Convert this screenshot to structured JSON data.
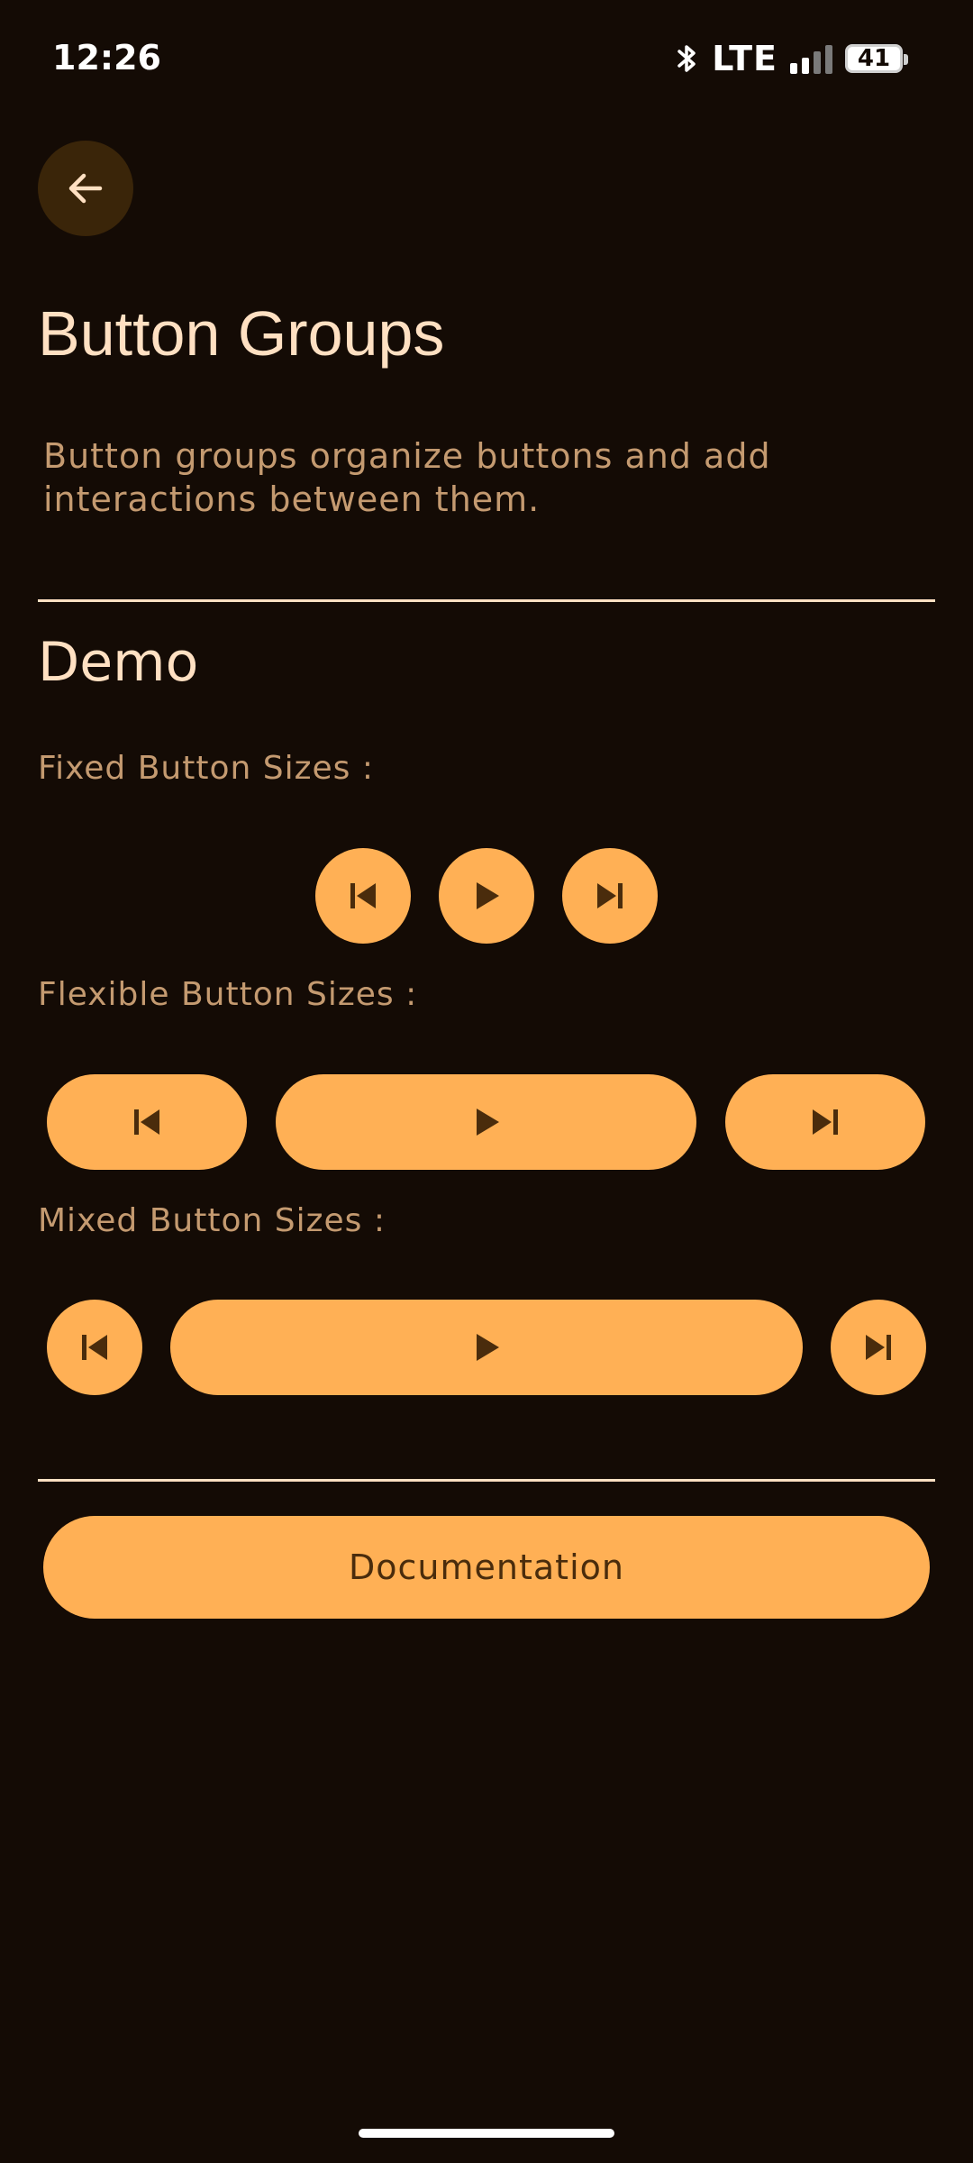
{
  "status_bar": {
    "time": "12:26",
    "network": "LTE",
    "battery": "41",
    "icons": [
      "bluetooth-icon",
      "signal-icon",
      "battery-icon"
    ]
  },
  "header": {
    "back_icon": "arrow-back-icon",
    "title": "Button Groups",
    "description": "Button groups organize buttons and add interactions between them."
  },
  "demo": {
    "section_title": "Demo",
    "fixed_label": "Fixed Button Sizes :",
    "flexible_label": "Flexible Button Sizes :",
    "mixed_label": "Mixed Button Sizes :",
    "button_icons": [
      "skip-previous-icon",
      "play-icon",
      "skip-next-icon"
    ]
  },
  "documentation_button": "Documentation",
  "colors": {
    "background": "#140b05",
    "accent": "#ffb055",
    "on_accent": "#4a2c0c",
    "title_text": "#ffe0c2",
    "secondary_text": "#c49a70",
    "back_button_bg": "#3a2509"
  }
}
